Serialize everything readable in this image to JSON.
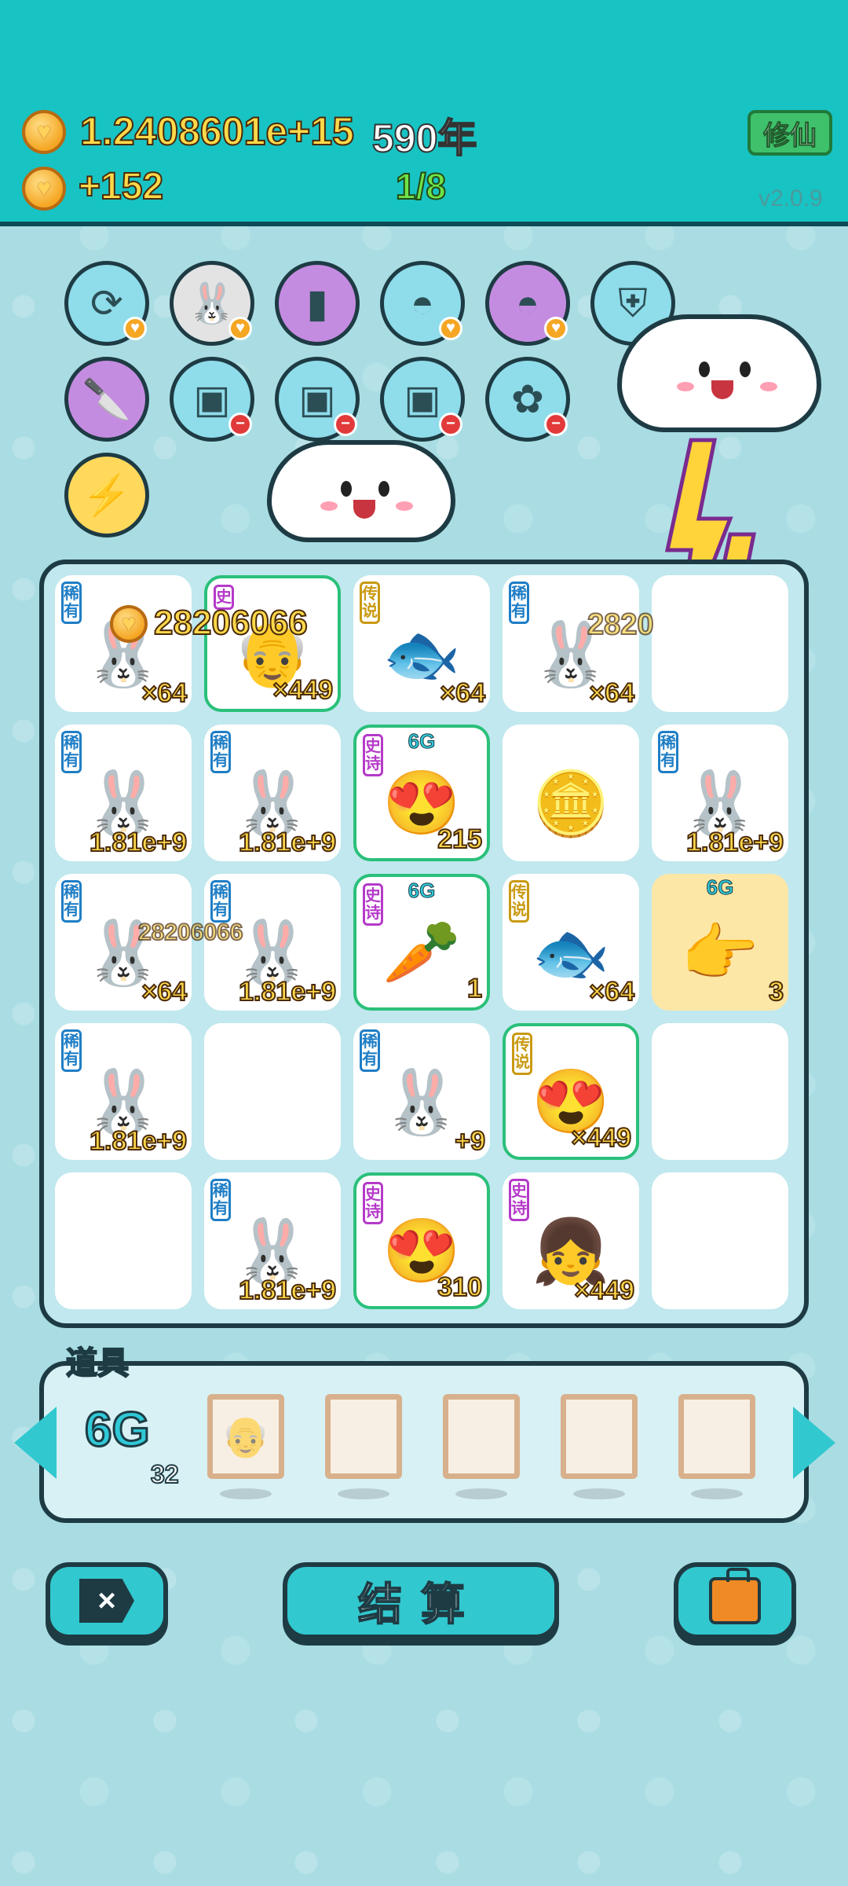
{
  "header": {
    "coins": "1.2408601e+15",
    "years": "590年",
    "income": "+152",
    "stage": "1/8",
    "xiuxian_label": "修仙",
    "version": "v2.0.9"
  },
  "skills": [
    {
      "name": "refresh-icon",
      "color": "blue",
      "badge": "coin"
    },
    {
      "name": "rabbit-icon",
      "color": "gray",
      "badge": "coin"
    },
    {
      "name": "traffic-light-icon",
      "color": "purple",
      "badge": ""
    },
    {
      "name": "rice-bowl-icon",
      "color": "blue",
      "badge": "coin"
    },
    {
      "name": "rice-bowl-icon",
      "color": "purple",
      "badge": "coin"
    },
    {
      "name": "shield-wrench-icon",
      "color": "blue",
      "badge": ""
    },
    {
      "name": "cleaver-icon",
      "color": "purple",
      "badge": ""
    },
    {
      "name": "sack-icon",
      "color": "blue",
      "badge": "minus"
    },
    {
      "name": "sack-icon",
      "color": "blue",
      "badge": "minus"
    },
    {
      "name": "sack-icon",
      "color": "blue",
      "badge": "minus"
    },
    {
      "name": "flower-pot-icon",
      "color": "blue",
      "badge": "minus"
    },
    {
      "name": "lightning-icon",
      "color": "gold",
      "badge": ""
    }
  ],
  "grid": {
    "cells": [
      {
        "tag": "稀有",
        "tag_type": "rare",
        "icon": "rabbit-icon",
        "count": "×64"
      },
      {
        "tag": "史",
        "tag_type": "epic",
        "icon": "king-icon",
        "count": "×449",
        "selected": true
      },
      {
        "tag": "传说",
        "tag_type": "legend",
        "icon": "fish-icon",
        "count": "×64"
      },
      {
        "tag": "稀有",
        "tag_type": "rare",
        "icon": "rabbit-icon",
        "count": "×64"
      },
      {
        "tag": "",
        "tag_type": "",
        "icon": "",
        "count": ""
      },
      {
        "tag": "稀有",
        "tag_type": "rare",
        "icon": "rabbit-icon",
        "count": "1.81e+9"
      },
      {
        "tag": "稀有",
        "tag_type": "rare",
        "icon": "rabbit-icon",
        "count": "1.81e+9"
      },
      {
        "tag": "史诗",
        "tag_type": "epic",
        "icon": "love-face-icon",
        "count": "215",
        "sixg": "6G",
        "selected": true
      },
      {
        "tag": "",
        "tag_type": "",
        "icon": "coins-icon",
        "count": ""
      },
      {
        "tag": "稀有",
        "tag_type": "rare",
        "icon": "rabbit-icon",
        "count": "1.81e+9"
      },
      {
        "tag": "稀有",
        "tag_type": "rare",
        "icon": "rabbit-icon",
        "count": "×64"
      },
      {
        "tag": "稀有",
        "tag_type": "rare",
        "icon": "rabbit-icon",
        "count": "1.81e+9"
      },
      {
        "tag": "史诗",
        "tag_type": "epic",
        "icon": "carrot-icon",
        "count": "1",
        "sixg": "6G",
        "selected": true
      },
      {
        "tag": "传说",
        "tag_type": "legend",
        "icon": "fish-icon",
        "count": "×64"
      },
      {
        "tag": "",
        "tag_type": "",
        "icon": "pointing-hand-icon",
        "count": "3",
        "sixg": "6G",
        "highlight": true
      },
      {
        "tag": "稀有",
        "tag_type": "rare",
        "icon": "rabbit-icon",
        "count": "1.81e+9"
      },
      {
        "tag": "",
        "tag_type": "",
        "icon": "",
        "count": ""
      },
      {
        "tag": "稀有",
        "tag_type": "rare",
        "icon": "rabbit-icon",
        "count": "+9"
      },
      {
        "tag": "传说",
        "tag_type": "legend",
        "icon": "love-face-icon",
        "count": "×449",
        "selected": true
      },
      {
        "tag": "",
        "tag_type": "",
        "icon": "",
        "count": ""
      },
      {
        "tag": "",
        "tag_type": "",
        "icon": "",
        "count": ""
      },
      {
        "tag": "稀有",
        "tag_type": "rare",
        "icon": "rabbit-icon",
        "count": "1.81e+9"
      },
      {
        "tag": "史诗",
        "tag_type": "epic",
        "icon": "love-face-icon",
        "count": "310",
        "selected": true
      },
      {
        "tag": "史诗",
        "tag_type": "epic",
        "icon": "girl-icon",
        "count": "×449"
      },
      {
        "tag": "",
        "tag_type": "",
        "icon": "",
        "count": ""
      }
    ]
  },
  "popups": [
    "28206066",
    "2820",
    "28206066"
  ],
  "props": {
    "title": "道具",
    "sixg_label": "6G",
    "sixg_count": "32"
  },
  "buttons": {
    "settle_label": "结算"
  },
  "colors": {
    "header_bg": "#18c3c4",
    "accent": "#32c8cf",
    "gold_text": "#ffd94a"
  }
}
